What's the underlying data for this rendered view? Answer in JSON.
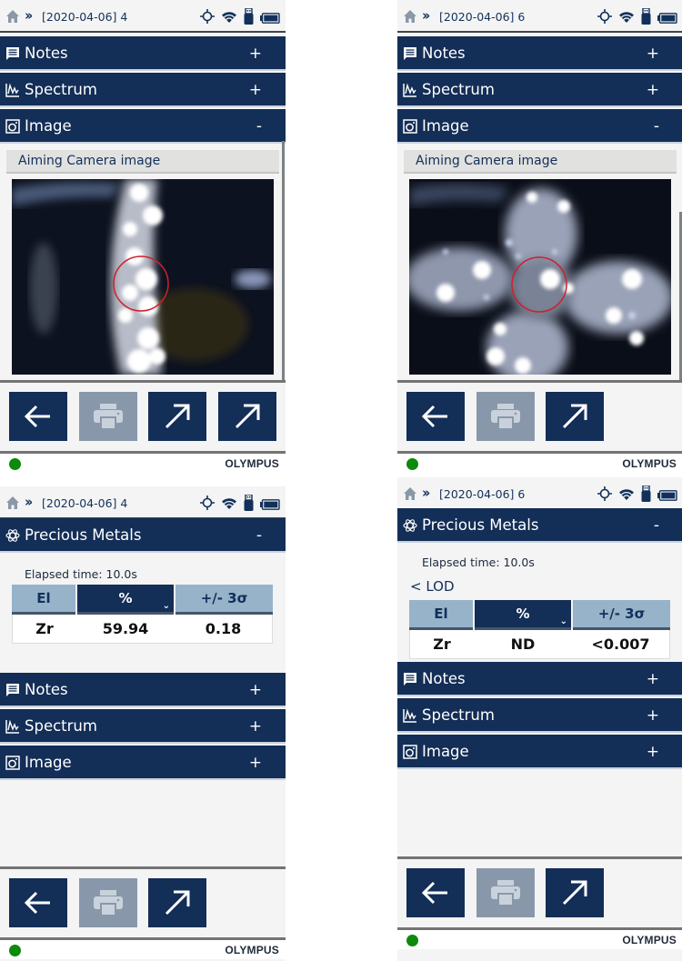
{
  "colors": {
    "header_bar": "#132e57",
    "table_header_light": "#96b3c9",
    "status_led": "#0b8a0b",
    "aim_circle": "#d0202a",
    "disabled_button": "#8898aa"
  },
  "screens": [
    {
      "statusbar": {
        "breadcrumb": "[2020-04-06] 4",
        "icons": [
          "home-icon",
          "double-chevron-icon",
          "gps-crosshair-icon",
          "wifi-icon",
          "usb-icon",
          "battery-icon"
        ]
      },
      "sections": [
        {
          "label": "Notes",
          "toggle": "+",
          "icon": "notes-icon"
        },
        {
          "label": "Spectrum",
          "toggle": "+",
          "icon": "spectrum-icon"
        },
        {
          "label": "Image",
          "toggle": "-",
          "icon": "image-icon"
        }
      ],
      "camera": {
        "title": "Aiming Camera image"
      },
      "toolbar": {
        "buttons": [
          "back",
          "print",
          "export",
          "export"
        ]
      },
      "footer": {
        "brand": "OLYMPUS"
      }
    },
    {
      "statusbar": {
        "breadcrumb": "[2020-04-06] 6"
      },
      "sections": [
        {
          "label": "Notes",
          "toggle": "+"
        },
        {
          "label": "Spectrum",
          "toggle": "+"
        },
        {
          "label": "Image",
          "toggle": "-"
        }
      ],
      "camera": {
        "title": "Aiming Camera image"
      },
      "toolbar": {
        "buttons": [
          "back",
          "print",
          "export"
        ]
      },
      "footer": {
        "brand": "OLYMPUS"
      }
    },
    {
      "statusbar": {
        "breadcrumb": "[2020-04-06] 4"
      },
      "results": {
        "title": "Precious Metals",
        "toggle": "-",
        "elapsed": "Elapsed time: 10.0s",
        "columns": [
          "El",
          "%",
          "+/- 3σ"
        ],
        "sort_indicator": "⌄",
        "rows": [
          {
            "el": "Zr",
            "pct": "59.94",
            "err": "0.18"
          }
        ]
      },
      "sections": [
        {
          "label": "Notes",
          "toggle": "+"
        },
        {
          "label": "Spectrum",
          "toggle": "+"
        },
        {
          "label": "Image",
          "toggle": "+"
        }
      ],
      "toolbar": {
        "buttons": [
          "back",
          "print",
          "export"
        ]
      },
      "footer": {
        "brand": "OLYMPUS"
      }
    },
    {
      "statusbar": {
        "breadcrumb": "[2020-04-06] 6"
      },
      "results": {
        "title": "Precious Metals",
        "toggle": "-",
        "elapsed": "Elapsed time: 10.0s",
        "lod_label": "< LOD",
        "columns": [
          "El",
          "%",
          "+/- 3σ"
        ],
        "sort_indicator": "⌄",
        "rows": [
          {
            "el": "Zr",
            "pct": "ND",
            "err": "<0.007"
          }
        ]
      },
      "sections": [
        {
          "label": "Notes",
          "toggle": "+"
        },
        {
          "label": "Spectrum",
          "toggle": "+"
        },
        {
          "label": "Image",
          "toggle": "+"
        }
      ],
      "toolbar": {
        "buttons": [
          "back",
          "print",
          "export"
        ]
      },
      "footer": {
        "brand": "OLYMPUS"
      }
    }
  ]
}
